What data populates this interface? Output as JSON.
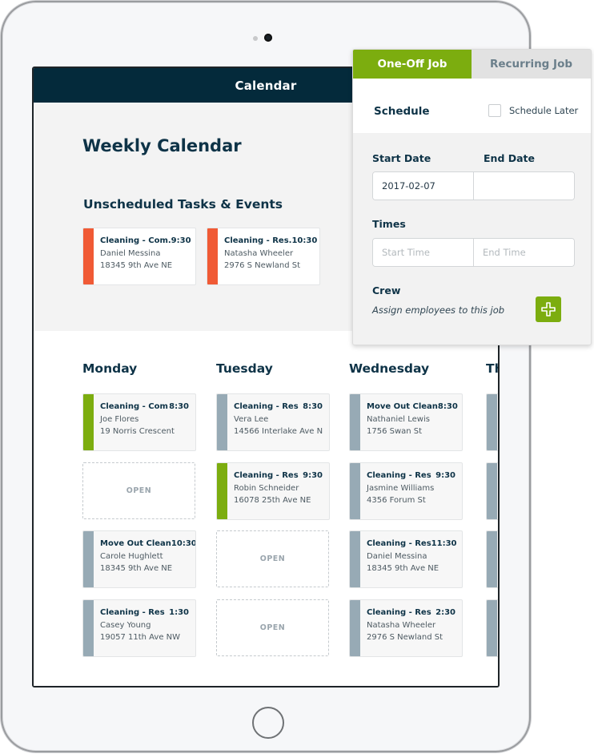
{
  "app": {
    "header_title": "Calendar"
  },
  "page": {
    "title": "Weekly Calendar",
    "unscheduled_title": "Unscheduled Tasks & Events"
  },
  "colors": {
    "accent_unscheduled": "#f05a35",
    "accent_scheduled": "#7cad0f",
    "accent_default": "#97aab5",
    "header_bg": "#042a3b",
    "brand_green": "#7cad0f"
  },
  "unscheduled": [
    {
      "type": "Cleaning - Com.",
      "time": "9:30",
      "client": "Daniel Messina",
      "address": "18345 9th Ave NE",
      "status": "unscheduled"
    },
    {
      "type": "Cleaning - Res.",
      "time": "10:30",
      "client": "Natasha Wheeler",
      "address": "2976 S Newland St",
      "status": "unscheduled"
    }
  ],
  "open_label": "OPEN",
  "days": [
    {
      "name": "Monday",
      "slots": [
        {
          "kind": "job",
          "type": "Cleaning - Com",
          "time": "8:30",
          "client": "Joe Flores",
          "address": "19 Norris Crescent",
          "status": "scheduled"
        },
        {
          "kind": "open"
        },
        {
          "kind": "job",
          "type": "Move Out Clean",
          "time": "10:30",
          "client": "Carole Hughlett",
          "address": "18345 9th Ave NE",
          "status": "default"
        },
        {
          "kind": "job",
          "type": "Cleaning - Res",
          "time": "1:30",
          "client": "Casey Young",
          "address": "19057 11th Ave NW",
          "status": "default"
        }
      ]
    },
    {
      "name": "Tuesday",
      "slots": [
        {
          "kind": "job",
          "type": "Cleaning - Res",
          "time": "8:30",
          "client": "Vera Lee",
          "address": "14566 Interlake Ave N",
          "status": "default"
        },
        {
          "kind": "job",
          "type": "Cleaning - Res",
          "time": "9:30",
          "client": "Robin Schneider",
          "address": "16078 25th Ave NE",
          "status": "scheduled"
        },
        {
          "kind": "open"
        },
        {
          "kind": "open"
        }
      ]
    },
    {
      "name": "Wednesday",
      "slots": [
        {
          "kind": "job",
          "type": "Move Out Clean",
          "time": "8:30",
          "client": "Nathaniel Lewis",
          "address": "1756 Swan St",
          "status": "default"
        },
        {
          "kind": "job",
          "type": "Cleaning - Res",
          "time": "9:30",
          "client": "Jasmine Williams",
          "address": "4356 Forum St",
          "status": "default"
        },
        {
          "kind": "job",
          "type": "Cleaning - Res",
          "time": "11:30",
          "client": "Daniel Messina",
          "address": "18345 9th Ave NE",
          "status": "default"
        },
        {
          "kind": "job",
          "type": "Cleaning - Res",
          "time": "2:30",
          "client": "Natasha Wheeler",
          "address": "2976 S Newland St",
          "status": "default"
        }
      ]
    },
    {
      "name": "Thursday",
      "slots": [
        {
          "kind": "job",
          "type": "",
          "time": "",
          "client": "",
          "address": "",
          "status": "default"
        },
        {
          "kind": "job",
          "type": "",
          "time": "",
          "client": "",
          "address": "",
          "status": "default"
        },
        {
          "kind": "job",
          "type": "",
          "time": "",
          "client": "",
          "address": "",
          "status": "default"
        },
        {
          "kind": "job",
          "type": "",
          "time": "",
          "client": "",
          "address": "",
          "status": "default"
        }
      ]
    }
  ],
  "job_panel": {
    "tabs": [
      {
        "label": "One-Off Job",
        "active": true
      },
      {
        "label": "Recurring Job",
        "active": false
      }
    ],
    "schedule_label": "Schedule",
    "schedule_later_label": "Schedule Later",
    "schedule_later_checked": false,
    "start_date_label": "Start Date",
    "end_date_label": "End Date",
    "start_date_value": "2017-02-07",
    "end_date_value": "",
    "times_label": "Times",
    "start_time_placeholder": "Start Time",
    "end_time_placeholder": "End Time",
    "crew_label": "Crew",
    "crew_hint": "Assign employees to this job",
    "add_crew_icon": "plus-icon"
  }
}
